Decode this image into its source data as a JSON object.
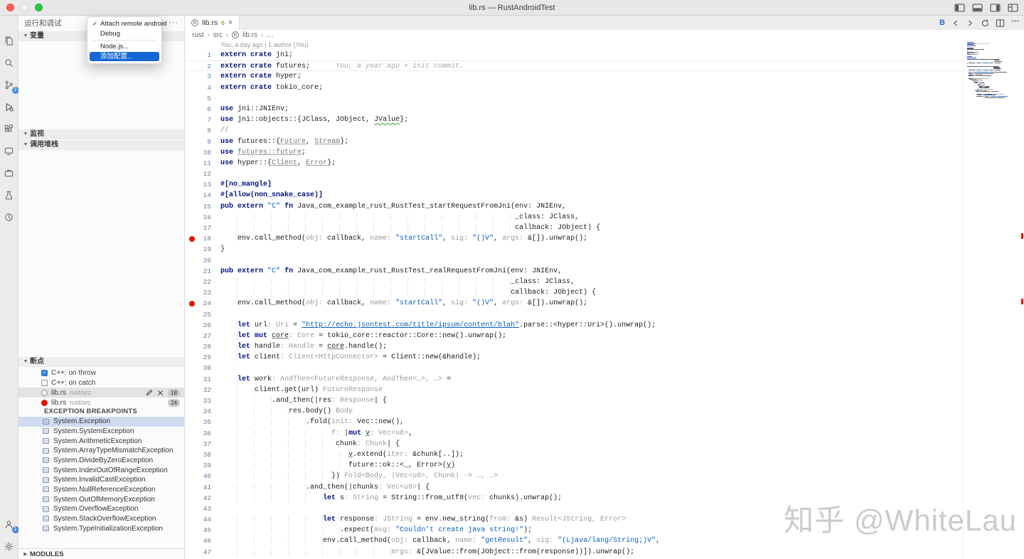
{
  "window": {
    "title": "lib.rs — RustAndroidTest"
  },
  "activity_bar": {
    "source_control_badge": "2",
    "account_badge": "1"
  },
  "sidebar": {
    "title": "运行和调试",
    "more_actions": "···",
    "sections": {
      "variables": "变量",
      "watch": "监视",
      "call_stack": "调用堆栈",
      "breakpoints": "断点",
      "exception_breakpoints": "EXCEPTION BREAKPOINTS",
      "modules": "MODULES"
    },
    "breakpoint_items": [
      {
        "label": "C++: on throw",
        "checked": true
      },
      {
        "label": "C++: on catch",
        "checked": false
      },
      {
        "file": "lib.rs",
        "path": "rust/src",
        "line": "18"
      },
      {
        "file": "lib.rs",
        "path": "rust/src",
        "line": "24"
      }
    ],
    "exception_items": [
      "System.Exception",
      "System.SystemException",
      "System.ArithmeticException",
      "System.ArrayTypeMismatchException",
      "System.DivideByZeroException",
      "System.IndexOutOfRangeException",
      "System.InvalidCastException",
      "System.NullReferenceException",
      "System.OutOfMemoryException",
      "System.OverflowException",
      "System.StackOverflowException",
      "System.TypeInitializationException"
    ]
  },
  "menu": {
    "items": [
      {
        "label": "Attach remote android",
        "checked": true
      },
      {
        "label": "Debug"
      },
      {
        "label": "Node.js...",
        "sep_before": true
      },
      {
        "label": "添加配置...",
        "selected": true
      }
    ]
  },
  "editor": {
    "tab": {
      "label": "lib.rs",
      "badge": "6",
      "close": "×"
    },
    "breadcrumbs": {
      "0": "rust",
      "1": "src",
      "2": "lib.rs",
      "3": "…"
    },
    "actions": {
      "bookmark_label": "B"
    },
    "codelens": "You, a day ago | 1 author (You)",
    "code": {
      "current_line": 2,
      "breakpoint_lines": [
        18,
        24
      ],
      "lines": [
        {
          "ind": 0,
          "t": [
            [
              "k",
              "extern crate"
            ],
            [
              "n",
              " jni;"
            ]
          ]
        },
        {
          "ind": 0,
          "t": [
            [
              "k",
              "extern crate"
            ],
            [
              "n",
              " futures;"
            ],
            [
              "blame",
              "      You, a year ago • init commit."
            ]
          ]
        },
        {
          "ind": 0,
          "t": [
            [
              "k",
              "extern crate"
            ],
            [
              "n",
              " hyper;"
            ]
          ]
        },
        {
          "ind": 0,
          "t": [
            [
              "k",
              "extern crate"
            ],
            [
              "n",
              " tokio_core;"
            ]
          ]
        },
        {
          "ind": 0,
          "t": []
        },
        {
          "ind": 0,
          "t": [
            [
              "k",
              "use"
            ],
            [
              "n",
              " jni::JNIEnv;"
            ]
          ]
        },
        {
          "ind": 0,
          "t": [
            [
              "k",
              "use"
            ],
            [
              "n",
              " jni::objects::{JClass, JObject, "
            ],
            [
              "g",
              "JValue"
            ],
            [
              "n",
              "};"
            ]
          ]
        },
        {
          "ind": 0,
          "t": [
            [
              "cm",
              "//"
            ]
          ]
        },
        {
          "ind": 0,
          "t": [
            [
              "k",
              "use"
            ],
            [
              "n",
              " futures::{"
            ],
            [
              "u",
              "Future"
            ],
            [
              "n",
              ", "
            ],
            [
              "u",
              "Stream"
            ],
            [
              "n",
              "};"
            ]
          ]
        },
        {
          "ind": 0,
          "t": [
            [
              "k",
              "use"
            ],
            [
              "n",
              " "
            ],
            [
              "u",
              "futures::future"
            ],
            [
              "n",
              ";"
            ]
          ]
        },
        {
          "ind": 0,
          "t": [
            [
              "k",
              "use"
            ],
            [
              "n",
              " hyper::{"
            ],
            [
              "u",
              "Client"
            ],
            [
              "n",
              ", "
            ],
            [
              "u",
              "Error"
            ],
            [
              "n",
              "};"
            ]
          ]
        },
        {
          "ind": 0,
          "t": []
        },
        {
          "ind": 0,
          "t": [
            [
              "m",
              "#[no_mangle]"
            ]
          ]
        },
        {
          "ind": 0,
          "t": [
            [
              "m",
              "#[allow(non_snake_case)]"
            ]
          ]
        },
        {
          "ind": 0,
          "t": [
            [
              "k",
              "pub extern"
            ],
            [
              "n",
              " "
            ],
            [
              "s",
              "\"C\""
            ],
            [
              "n",
              " "
            ],
            [
              "k",
              "fn"
            ],
            [
              "n",
              " Java_com_example_rust_RustTest_startRequestFromJni(env: JNIEnv,"
            ]
          ]
        },
        {
          "ind": 69,
          "t": [
            [
              "n",
              "_class: JClass,"
            ]
          ]
        },
        {
          "ind": 69,
          "t": [
            [
              "n",
              "callback: JObject) {"
            ]
          ]
        },
        {
          "ind": 4,
          "t": [
            [
              "n",
              "env.call_method("
            ],
            [
              "i",
              "obj: "
            ],
            [
              "n",
              "callback, "
            ],
            [
              "i",
              "name: "
            ],
            [
              "s",
              "\"startCall\""
            ],
            [
              "n",
              ", "
            ],
            [
              "i",
              "sig: "
            ],
            [
              "s",
              "\"()V\""
            ],
            [
              "n",
              ", "
            ],
            [
              "i",
              "args: "
            ],
            [
              "n",
              "&[]).unwrap();"
            ]
          ]
        },
        {
          "ind": 0,
          "t": [
            [
              "n",
              "}"
            ]
          ]
        },
        {
          "ind": 0,
          "t": []
        },
        {
          "ind": 0,
          "t": [
            [
              "k",
              "pub extern"
            ],
            [
              "n",
              " "
            ],
            [
              "s",
              "\"C\""
            ],
            [
              "n",
              " "
            ],
            [
              "k",
              "fn"
            ],
            [
              "n",
              " Java_com_example_rust_RustTest_realRequestFromJni(env: JNIEnv,"
            ]
          ]
        },
        {
          "ind": 68,
          "t": [
            [
              "n",
              "_class: JClass,"
            ]
          ]
        },
        {
          "ind": 68,
          "t": [
            [
              "n",
              "callback: JObject) {"
            ]
          ]
        },
        {
          "ind": 4,
          "t": [
            [
              "n",
              "env.call_method("
            ],
            [
              "i",
              "obj: "
            ],
            [
              "n",
              "callback, "
            ],
            [
              "i",
              "name: "
            ],
            [
              "s",
              "\"startCall\""
            ],
            [
              "n",
              ", "
            ],
            [
              "i",
              "sig: "
            ],
            [
              "s",
              "\"()V\""
            ],
            [
              "n",
              ", "
            ],
            [
              "i",
              "args: "
            ],
            [
              "n",
              "&[]).unwrap();"
            ]
          ]
        },
        {
          "ind": 0,
          "t": []
        },
        {
          "ind": 4,
          "t": [
            [
              "k",
              "let"
            ],
            [
              "n",
              " url"
            ],
            [
              "i",
              ": Uri"
            ],
            [
              "n",
              " = "
            ],
            [
              "su",
              "\"http://echo.jsontest.com/title/ipsum/content/blah\""
            ],
            [
              "n",
              ".parse::<hyper::Uri>().unwrap();"
            ]
          ]
        },
        {
          "ind": 4,
          "t": [
            [
              "k",
              "let mut"
            ],
            [
              "n",
              " "
            ],
            [
              "mv",
              "core"
            ],
            [
              "i",
              ": Core"
            ],
            [
              "n",
              " = tokio_core::reactor::Core::new().unwrap();"
            ]
          ]
        },
        {
          "ind": 4,
          "t": [
            [
              "k",
              "let"
            ],
            [
              "n",
              " handle"
            ],
            [
              "i",
              ": Handle"
            ],
            [
              "n",
              " = "
            ],
            [
              "mv",
              "core"
            ],
            [
              "n",
              ".handle();"
            ]
          ]
        },
        {
          "ind": 4,
          "t": [
            [
              "k",
              "let"
            ],
            [
              "n",
              " client"
            ],
            [
              "i",
              ": Client<HttpConnector>"
            ],
            [
              "n",
              " = Client::new(&handle);"
            ]
          ]
        },
        {
          "ind": 0,
          "t": []
        },
        {
          "ind": 4,
          "t": [
            [
              "k",
              "let"
            ],
            [
              "n",
              " work"
            ],
            [
              "i",
              ": AndThen<FutureResponse, AndThen<…>, …>"
            ],
            [
              "n",
              " ="
            ]
          ]
        },
        {
          "ind": 8,
          "t": [
            [
              "n",
              "client.get(url) "
            ],
            [
              "i",
              "FutureResponse"
            ]
          ]
        },
        {
          "ind": 12,
          "t": [
            [
              "n",
              ".and_then(|res"
            ],
            [
              "i",
              ": Response"
            ],
            [
              "n",
              "| {"
            ]
          ]
        },
        {
          "ind": 16,
          "t": [
            [
              "n",
              "res.body() "
            ],
            [
              "i",
              "Body"
            ]
          ]
        },
        {
          "ind": 20,
          "t": [
            [
              "n",
              ".fold("
            ],
            [
              "i",
              "init: "
            ],
            [
              "n",
              "Vec::new(),"
            ]
          ]
        },
        {
          "ind": 26,
          "t": [
            [
              "i",
              "f: "
            ],
            [
              "n",
              "|"
            ],
            [
              "k",
              "mut"
            ],
            [
              "n",
              " "
            ],
            [
              "mv",
              "v"
            ],
            [
              "i",
              ": Vec<u8>"
            ],
            [
              "n",
              ","
            ]
          ]
        },
        {
          "ind": 27,
          "t": [
            [
              "n",
              "chunk"
            ],
            [
              "i",
              ": Chunk"
            ],
            [
              "n",
              "| {"
            ]
          ]
        },
        {
          "ind": 30,
          "t": [
            [
              "mv",
              "v"
            ],
            [
              "n",
              ".extend("
            ],
            [
              "i",
              "iter: "
            ],
            [
              "n",
              "&chunk[..]);"
            ]
          ]
        },
        {
          "ind": 30,
          "t": [
            [
              "n",
              "future::ok::<_, Error>("
            ],
            [
              "mv",
              "v"
            ],
            [
              "n",
              ")"
            ]
          ]
        },
        {
          "ind": 26,
          "t": [
            [
              "n",
              "}) "
            ],
            [
              "i",
              "Fold<Body, |Vec<u8>, Chunk| -> …, …>"
            ]
          ]
        },
        {
          "ind": 20,
          "t": [
            [
              "n",
              ".and_then(|chunks"
            ],
            [
              "i",
              ": Vec<u8>"
            ],
            [
              "n",
              "| {"
            ]
          ]
        },
        {
          "ind": 24,
          "t": [
            [
              "k",
              "let"
            ],
            [
              "n",
              " s"
            ],
            [
              "i",
              ": String"
            ],
            [
              "n",
              " = String::from_utf8("
            ],
            [
              "i",
              "vec: "
            ],
            [
              "n",
              "chunks).unwrap();"
            ]
          ]
        },
        {
          "ind": 0,
          "t": []
        },
        {
          "ind": 24,
          "t": [
            [
              "k",
              "let"
            ],
            [
              "n",
              " response"
            ],
            [
              "i",
              ": JString"
            ],
            [
              "n",
              " = env.new_string("
            ],
            [
              "i",
              "from: "
            ],
            [
              "n",
              "&s) "
            ],
            [
              "i",
              "Result<JString, Error>"
            ]
          ]
        },
        {
          "ind": 28,
          "t": [
            [
              "n",
              ".expect("
            ],
            [
              "i",
              "msg: "
            ],
            [
              "s",
              "\"Couldn't create java string!\""
            ],
            [
              "n",
              ");"
            ]
          ]
        },
        {
          "ind": 24,
          "t": [
            [
              "n",
              "env.call_method("
            ],
            [
              "i",
              "obj: "
            ],
            [
              "n",
              "callback, "
            ],
            [
              "i",
              "name: "
            ],
            [
              "s",
              "\"getResult\""
            ],
            [
              "n",
              ", "
            ],
            [
              "i",
              "sig: "
            ],
            [
              "s",
              "\"(Ljava/lang/String;)V\""
            ],
            [
              "n",
              ","
            ]
          ]
        },
        {
          "ind": 40,
          "t": [
            [
              "i",
              "args: "
            ],
            [
              "n",
              "&[JValue::from(JObject::from(response))]).unwrap();"
            ]
          ]
        }
      ]
    }
  },
  "watermark": "知乎 @WhiteLau",
  "theme": {
    "accent": "#1467d6",
    "breakpoint_red": "#e51400",
    "badge_blue": "#2a7ad2",
    "keyword_navy": "#001080",
    "string_blue": "#0a5dc2",
    "selection_row": "#cfdcf0"
  }
}
